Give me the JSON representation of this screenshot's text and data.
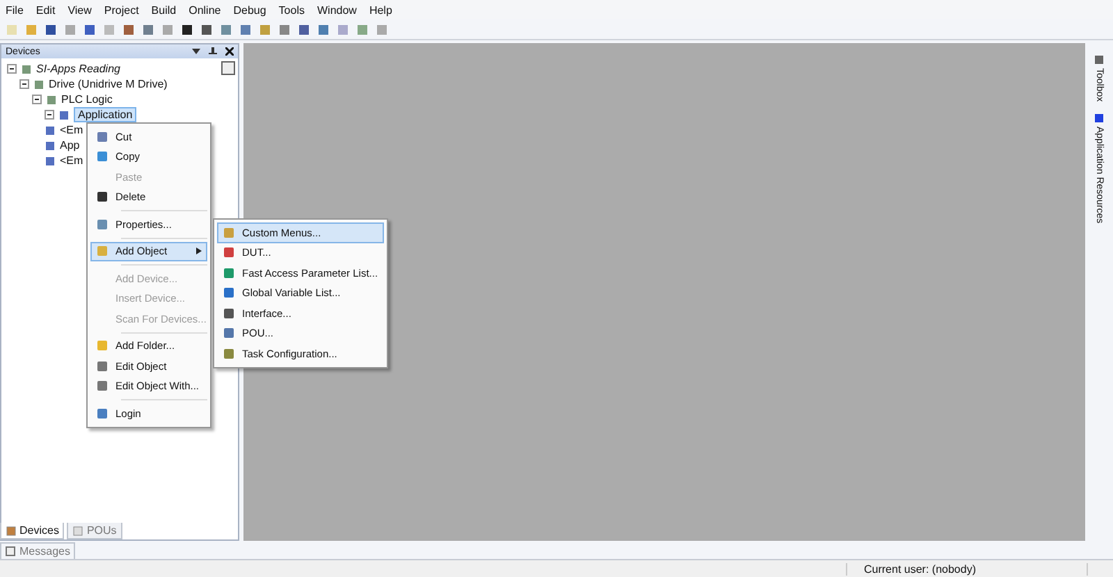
{
  "menu_bar": [
    "File",
    "Edit",
    "View",
    "Project",
    "Build",
    "Online",
    "Debug",
    "Tools",
    "Window",
    "Help"
  ],
  "devices_panel": {
    "title": "Devices",
    "tree": [
      {
        "label": "SI-Apps Reading",
        "expanded": true,
        "children": [
          {
            "label": "Drive (Unidrive M Drive)",
            "expanded": true,
            "children": [
              {
                "label": "PLC Logic",
                "expanded": true,
                "children": [
                  {
                    "label": "Application",
                    "expanded": true,
                    "selected": true
                  },
                  {
                    "label": "<Em",
                    "selected": false
                  },
                  {
                    "label": "App",
                    "selected": false
                  },
                  {
                    "label": "<Em",
                    "selected": false
                  }
                ]
              }
            ]
          }
        ]
      }
    ]
  },
  "context_menu": [
    {
      "label": "Cut",
      "disabled": false,
      "selected": false,
      "separator_before": false
    },
    {
      "label": "Copy",
      "disabled": false,
      "selected": false,
      "separator_before": false
    },
    {
      "label": "Paste",
      "disabled": true,
      "selected": false,
      "separator_before": false
    },
    {
      "label": "Delete",
      "disabled": false,
      "selected": false,
      "separator_before": false
    },
    {
      "label": "Properties...",
      "disabled": false,
      "selected": false,
      "separator_before": true
    },
    {
      "label": "Add Object",
      "disabled": false,
      "selected": true,
      "separator_before": true,
      "submenu": true
    },
    {
      "label": "Add Device...",
      "disabled": true,
      "selected": false,
      "separator_before": true
    },
    {
      "label": "Insert Device...",
      "disabled": true,
      "selected": false,
      "separator_before": false
    },
    {
      "label": "Scan For Devices...",
      "disabled": true,
      "selected": false,
      "separator_before": false
    },
    {
      "label": "Add Folder...",
      "disabled": false,
      "selected": false,
      "separator_before": true
    },
    {
      "label": "Edit Object",
      "disabled": false,
      "selected": false,
      "separator_before": false
    },
    {
      "label": "Edit Object With...",
      "disabled": false,
      "selected": false,
      "separator_before": false
    },
    {
      "label": "Login",
      "disabled": false,
      "selected": false,
      "separator_before": true
    }
  ],
  "submenu": [
    {
      "label": "Custom Menus...",
      "selected": true
    },
    {
      "label": "DUT...",
      "selected": false
    },
    {
      "label": "Fast Access Parameter List...",
      "selected": false
    },
    {
      "label": "Global Variable List...",
      "selected": false
    },
    {
      "label": "Interface...",
      "selected": false
    },
    {
      "label": "POU...",
      "selected": false
    },
    {
      "label": "Task Configuration...",
      "selected": false
    }
  ],
  "panel_tabs": [
    {
      "label": "Devices",
      "selected": true
    },
    {
      "label": "POUs",
      "selected": false
    }
  ],
  "side_tabs": [
    "Toolbox",
    "Application Resources"
  ],
  "bottom_tab": "Messages",
  "status_bar": "Current user: (nobody)"
}
